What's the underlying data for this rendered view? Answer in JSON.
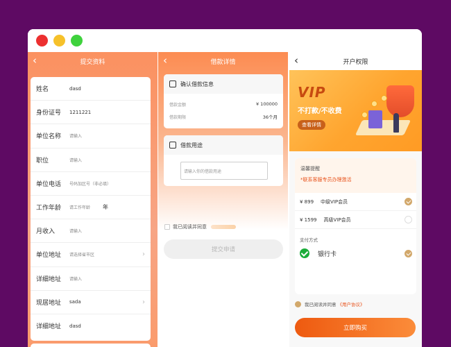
{
  "screen1": {
    "back": "‹",
    "title": "提交资料",
    "fields": [
      {
        "label": "姓名",
        "value": "dasd"
      },
      {
        "label": "身份证号",
        "value": "1211221"
      },
      {
        "label": "单位名称",
        "placeholder": "请输入"
      },
      {
        "label": "职位",
        "placeholder": "请输入"
      },
      {
        "label": "单位电话",
        "placeholder": "号码加区号（非必填）"
      },
      {
        "label": "工作年龄",
        "placeholder": "请工作年龄",
        "unit": "年"
      },
      {
        "label": "月收入",
        "placeholder": "请输入"
      },
      {
        "label": "单位地址",
        "placeholder": "请选择省市区"
      },
      {
        "label": "详细地址",
        "placeholder": "请输入"
      },
      {
        "label": "现居地址",
        "value": "sada"
      },
      {
        "label": "详细地址",
        "value": "dasd"
      }
    ],
    "chevron": "›"
  },
  "screen2": {
    "back": "‹",
    "title": "借款详情",
    "confirm_title": "确认借款信息",
    "amount_label": "借款金额",
    "amount_value": "¥ 100000",
    "term_label": "借款期限",
    "term_value": "36个月",
    "purpose_title": "借款用途",
    "purpose_placeholder": "请输入你的借款用途",
    "agree_text": "我已阅读并同意",
    "submit_label": "提交申请"
  },
  "screen3": {
    "back": "‹",
    "title": "开户权限",
    "banner_vip": "VIP",
    "banner_slogan": "不打款/不收费",
    "banner_detail": "查看详情",
    "notice_title": "温馨提醒",
    "notice_text": "*联系客服专员办理激活",
    "plans": [
      {
        "price": "¥ 899",
        "name": "中级VIP会员",
        "selected": true
      },
      {
        "price": "¥ 1599",
        "name": "高级VIP会员",
        "selected": false
      }
    ],
    "pay_label": "支付方式",
    "pay_method": "银行卡",
    "agree_text": "我已阅读并同意",
    "agree_link": "《用户协议》",
    "buy_label": "立即购买"
  },
  "colors": {
    "background": "#5e0a63",
    "accent": "#ee5a10",
    "gold": "#d2a86b"
  }
}
